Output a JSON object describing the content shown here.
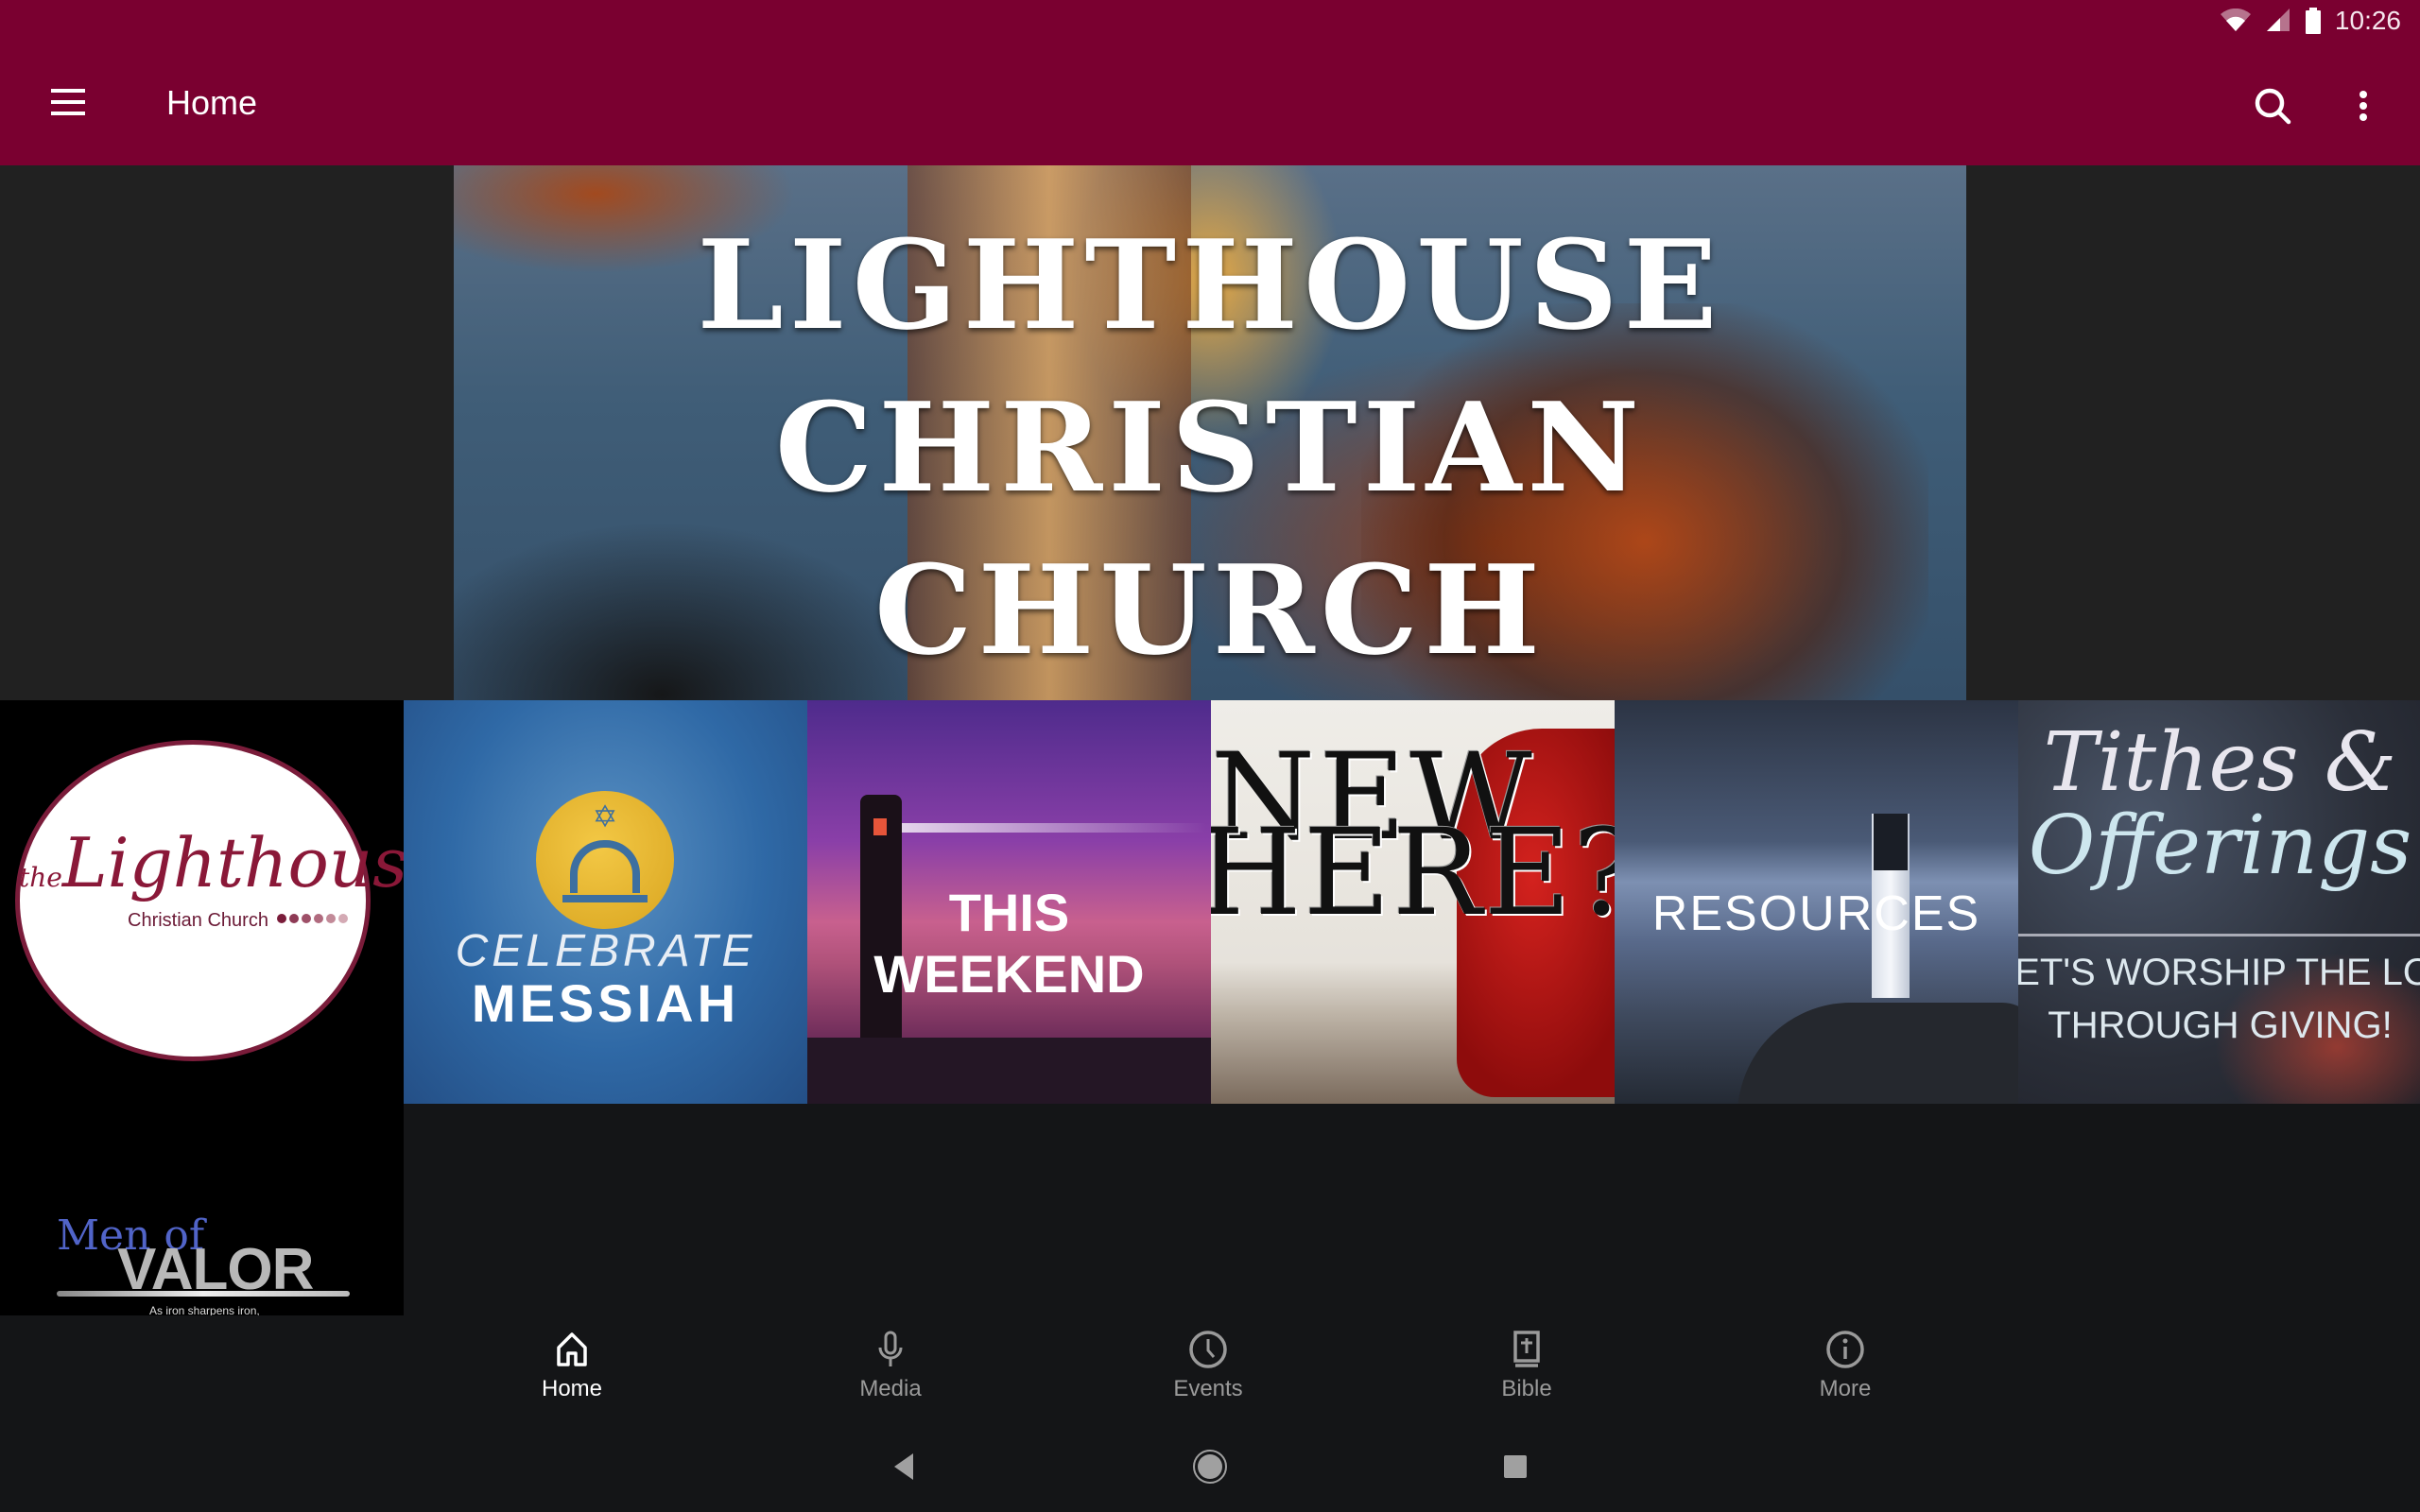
{
  "status_bar": {
    "time": "10:26",
    "icons": [
      "wifi-icon",
      "cell-signal-icon",
      "battery-icon"
    ]
  },
  "toolbar": {
    "title": "Home",
    "menu_icon": "hamburger-menu-icon",
    "search_icon": "search-icon",
    "overflow_icon": "more-vert-icon",
    "color": "#7a0030"
  },
  "banner": {
    "lines": [
      "LIGHTHOUSE",
      "CHRISTIAN",
      "CHURCH"
    ]
  },
  "tiles": [
    {
      "name": "lighthouse-logo",
      "script_prefix": "the",
      "script": "Lighthouse",
      "subtitle": "Christian Church"
    },
    {
      "name": "celebrate-messiah",
      "line1": "CELEBRATE",
      "line2": "MESSIAH",
      "symbol": "✡"
    },
    {
      "name": "this-weekend",
      "caption": "THIS WEEKEND"
    },
    {
      "name": "new-here",
      "line1": "NEW",
      "line2": "HERE?"
    },
    {
      "name": "resources",
      "caption": "RESOURCES"
    },
    {
      "name": "tithes-offerings",
      "line1": "Tithes &",
      "line2": "Offerings",
      "line3": "LET'S WORSHIP THE LORD",
      "line4": "THROUGH GIVING!"
    },
    {
      "name": "men-of-valor",
      "line1": "Men of",
      "line2": "VALOR",
      "verse": "As iron sharpens iron,"
    }
  ],
  "bottom_nav": {
    "active": "Home",
    "items": [
      {
        "label": "Home",
        "icon": "home-icon"
      },
      {
        "label": "Media",
        "icon": "microphone-icon"
      },
      {
        "label": "Events",
        "icon": "clock-icon"
      },
      {
        "label": "Bible",
        "icon": "bible-icon"
      },
      {
        "label": "More",
        "icon": "info-icon"
      }
    ]
  },
  "system_nav": {
    "buttons": [
      "back",
      "home",
      "recents"
    ]
  }
}
